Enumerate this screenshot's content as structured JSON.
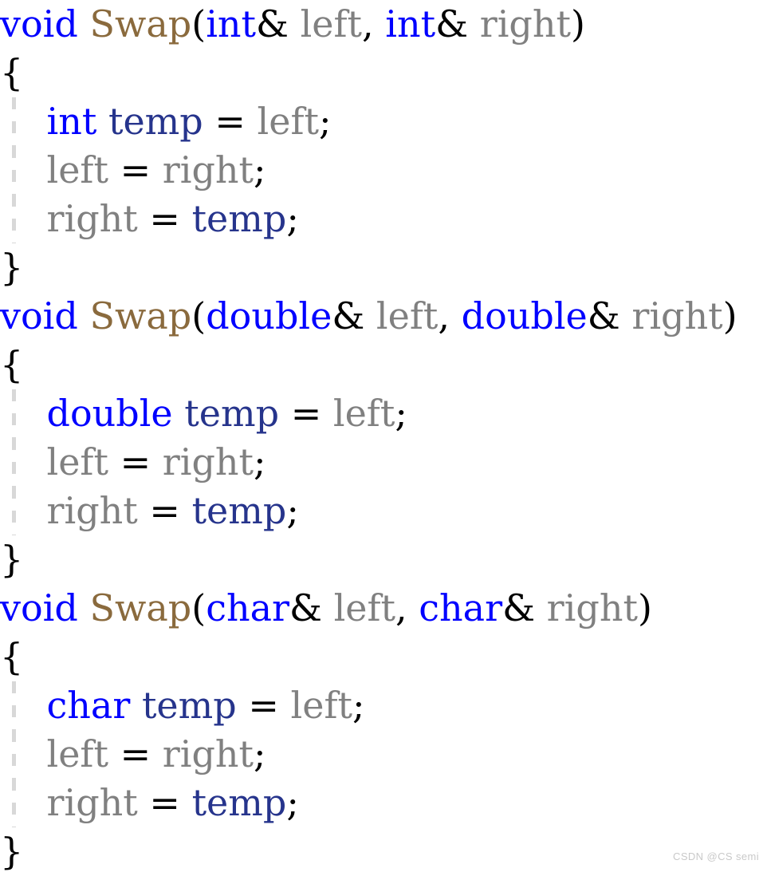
{
  "document": {
    "kind": "code-snippet",
    "language": "C++",
    "watermark": "CSDN @CS semi"
  },
  "palette": {
    "background": "#ffffff",
    "keyword": "#0000ff",
    "function_name": "#8a6a3d",
    "parameter": "#808080",
    "local_variable": "#26348c",
    "punctuation": "#000000",
    "indent_guide": "#d8d8d8",
    "watermark": "#c9c9c9"
  },
  "code": {
    "lines": [
      {
        "id": "line-1",
        "guide": false,
        "tokens": [
          {
            "text": "void",
            "kind": "keyword"
          },
          {
            "text": " ",
            "kind": "plain"
          },
          {
            "text": "Swap",
            "kind": "function"
          },
          {
            "text": "(",
            "kind": "punct"
          },
          {
            "text": "int",
            "kind": "keyword"
          },
          {
            "text": "& ",
            "kind": "punct"
          },
          {
            "text": "left",
            "kind": "parameter"
          },
          {
            "text": ", ",
            "kind": "punct"
          },
          {
            "text": "int",
            "kind": "keyword"
          },
          {
            "text": "& ",
            "kind": "punct"
          },
          {
            "text": "right",
            "kind": "parameter"
          },
          {
            "text": ")",
            "kind": "punct"
          }
        ]
      },
      {
        "id": "line-2",
        "guide": false,
        "tokens": [
          {
            "text": "{",
            "kind": "punct"
          }
        ]
      },
      {
        "id": "line-3",
        "guide": true,
        "tokens": [
          {
            "text": "    ",
            "kind": "plain"
          },
          {
            "text": "int",
            "kind": "keyword"
          },
          {
            "text": " ",
            "kind": "plain"
          },
          {
            "text": "temp",
            "kind": "local"
          },
          {
            "text": " ",
            "kind": "plain"
          },
          {
            "text": "=",
            "kind": "punct"
          },
          {
            "text": " ",
            "kind": "plain"
          },
          {
            "text": "left",
            "kind": "parameter"
          },
          {
            "text": ";",
            "kind": "punct"
          }
        ]
      },
      {
        "id": "line-4",
        "guide": true,
        "tokens": [
          {
            "text": "    ",
            "kind": "plain"
          },
          {
            "text": "left",
            "kind": "parameter"
          },
          {
            "text": " ",
            "kind": "plain"
          },
          {
            "text": "=",
            "kind": "punct"
          },
          {
            "text": " ",
            "kind": "plain"
          },
          {
            "text": "right",
            "kind": "parameter"
          },
          {
            "text": ";",
            "kind": "punct"
          }
        ]
      },
      {
        "id": "line-5",
        "guide": true,
        "tokens": [
          {
            "text": "    ",
            "kind": "plain"
          },
          {
            "text": "right",
            "kind": "parameter"
          },
          {
            "text": " ",
            "kind": "plain"
          },
          {
            "text": "=",
            "kind": "punct"
          },
          {
            "text": " ",
            "kind": "plain"
          },
          {
            "text": "temp",
            "kind": "local"
          },
          {
            "text": ";",
            "kind": "punct"
          }
        ]
      },
      {
        "id": "line-6",
        "guide": false,
        "tokens": [
          {
            "text": "}",
            "kind": "punct"
          }
        ]
      },
      {
        "id": "line-7",
        "guide": false,
        "tokens": [
          {
            "text": "void",
            "kind": "keyword"
          },
          {
            "text": " ",
            "kind": "plain"
          },
          {
            "text": "Swap",
            "kind": "function"
          },
          {
            "text": "(",
            "kind": "punct"
          },
          {
            "text": "double",
            "kind": "keyword"
          },
          {
            "text": "& ",
            "kind": "punct"
          },
          {
            "text": "left",
            "kind": "parameter"
          },
          {
            "text": ", ",
            "kind": "punct"
          },
          {
            "text": "double",
            "kind": "keyword"
          },
          {
            "text": "& ",
            "kind": "punct"
          },
          {
            "text": "right",
            "kind": "parameter"
          },
          {
            "text": ")",
            "kind": "punct"
          }
        ]
      },
      {
        "id": "line-8",
        "guide": false,
        "tokens": [
          {
            "text": "{",
            "kind": "punct"
          }
        ]
      },
      {
        "id": "line-9",
        "guide": true,
        "tokens": [
          {
            "text": "    ",
            "kind": "plain"
          },
          {
            "text": "double",
            "kind": "keyword"
          },
          {
            "text": " ",
            "kind": "plain"
          },
          {
            "text": "temp",
            "kind": "local"
          },
          {
            "text": " ",
            "kind": "plain"
          },
          {
            "text": "=",
            "kind": "punct"
          },
          {
            "text": " ",
            "kind": "plain"
          },
          {
            "text": "left",
            "kind": "parameter"
          },
          {
            "text": ";",
            "kind": "punct"
          }
        ]
      },
      {
        "id": "line-10",
        "guide": true,
        "tokens": [
          {
            "text": "    ",
            "kind": "plain"
          },
          {
            "text": "left",
            "kind": "parameter"
          },
          {
            "text": " ",
            "kind": "plain"
          },
          {
            "text": "=",
            "kind": "punct"
          },
          {
            "text": " ",
            "kind": "plain"
          },
          {
            "text": "right",
            "kind": "parameter"
          },
          {
            "text": ";",
            "kind": "punct"
          }
        ]
      },
      {
        "id": "line-11",
        "guide": true,
        "tokens": [
          {
            "text": "    ",
            "kind": "plain"
          },
          {
            "text": "right",
            "kind": "parameter"
          },
          {
            "text": " ",
            "kind": "plain"
          },
          {
            "text": "=",
            "kind": "punct"
          },
          {
            "text": " ",
            "kind": "plain"
          },
          {
            "text": "temp",
            "kind": "local"
          },
          {
            "text": ";",
            "kind": "punct"
          }
        ]
      },
      {
        "id": "line-12",
        "guide": false,
        "tokens": [
          {
            "text": "}",
            "kind": "punct"
          }
        ]
      },
      {
        "id": "line-13",
        "guide": false,
        "tokens": [
          {
            "text": "void",
            "kind": "keyword"
          },
          {
            "text": " ",
            "kind": "plain"
          },
          {
            "text": "Swap",
            "kind": "function"
          },
          {
            "text": "(",
            "kind": "punct"
          },
          {
            "text": "char",
            "kind": "keyword"
          },
          {
            "text": "& ",
            "kind": "punct"
          },
          {
            "text": "left",
            "kind": "parameter"
          },
          {
            "text": ", ",
            "kind": "punct"
          },
          {
            "text": "char",
            "kind": "keyword"
          },
          {
            "text": "& ",
            "kind": "punct"
          },
          {
            "text": "right",
            "kind": "parameter"
          },
          {
            "text": ")",
            "kind": "punct"
          }
        ]
      },
      {
        "id": "line-14",
        "guide": false,
        "tokens": [
          {
            "text": "{",
            "kind": "punct"
          }
        ]
      },
      {
        "id": "line-15",
        "guide": true,
        "tokens": [
          {
            "text": "    ",
            "kind": "plain"
          },
          {
            "text": "char",
            "kind": "keyword"
          },
          {
            "text": " ",
            "kind": "plain"
          },
          {
            "text": "temp",
            "kind": "local"
          },
          {
            "text": " ",
            "kind": "plain"
          },
          {
            "text": "=",
            "kind": "punct"
          },
          {
            "text": " ",
            "kind": "plain"
          },
          {
            "text": "left",
            "kind": "parameter"
          },
          {
            "text": ";",
            "kind": "punct"
          }
        ]
      },
      {
        "id": "line-16",
        "guide": true,
        "tokens": [
          {
            "text": "    ",
            "kind": "plain"
          },
          {
            "text": "left",
            "kind": "parameter"
          },
          {
            "text": " ",
            "kind": "plain"
          },
          {
            "text": "=",
            "kind": "punct"
          },
          {
            "text": " ",
            "kind": "plain"
          },
          {
            "text": "right",
            "kind": "parameter"
          },
          {
            "text": ";",
            "kind": "punct"
          }
        ]
      },
      {
        "id": "line-17",
        "guide": true,
        "tokens": [
          {
            "text": "    ",
            "kind": "plain"
          },
          {
            "text": "right",
            "kind": "parameter"
          },
          {
            "text": " ",
            "kind": "plain"
          },
          {
            "text": "=",
            "kind": "punct"
          },
          {
            "text": " ",
            "kind": "plain"
          },
          {
            "text": "temp",
            "kind": "local"
          },
          {
            "text": ";",
            "kind": "punct"
          }
        ]
      },
      {
        "id": "line-18",
        "guide": false,
        "tokens": [
          {
            "text": "}",
            "kind": "punct"
          }
        ]
      }
    ]
  }
}
